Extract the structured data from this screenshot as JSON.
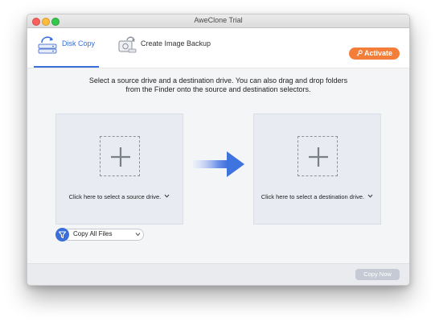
{
  "window": {
    "title": "AweClone Trial"
  },
  "toolbar": {
    "tabs": [
      {
        "label": "Disk Copy",
        "icon": "disk-copy-icon",
        "active": true
      },
      {
        "label": "Create Image Backup",
        "icon": "image-backup-icon",
        "active": false
      }
    ],
    "activate_label": "Activate",
    "activate_icon": "key-icon"
  },
  "main": {
    "instruction_line1": "Select a source drive and a destination drive. You can also drag and drop folders",
    "instruction_line2": "from the Finder onto the source and destination selectors.",
    "source": {
      "label": "Click here to select a source drive."
    },
    "destination": {
      "label": "Click here to select a destination drive."
    },
    "filter": {
      "selected": "Copy All Files",
      "icon": "filter-icon"
    }
  },
  "footer": {
    "copy_now_label": "Copy Now"
  },
  "colors": {
    "accent": "#3a6fd8",
    "activate": "#f37e3a",
    "panel": "#e8ebf1",
    "disabled_button": "#c5cad4"
  }
}
